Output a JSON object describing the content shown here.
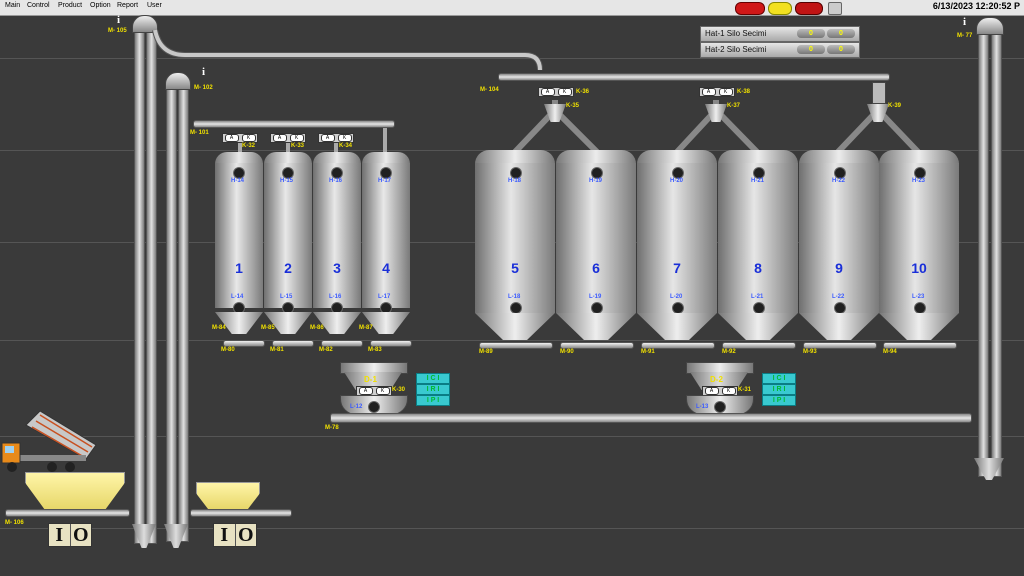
{
  "menu": [
    "Main",
    "Control",
    "Product",
    "Option",
    "Report",
    "User"
  ],
  "datetime": "6/13/2023 12:20:52 P",
  "line_panel": {
    "rows": [
      {
        "label": "Hat-1 Silo Secimi",
        "v1": "0",
        "v2": "0"
      },
      {
        "label": "Hat-2 Silo Secimi",
        "v1": "0",
        "v2": "0"
      }
    ]
  },
  "elevators": {
    "m105": "M- 105",
    "m102": "M- 102",
    "m101": "M- 101",
    "m104": "M- 104",
    "m77": "M- 77",
    "m106": "M- 106",
    "m78": "M-78"
  },
  "valves_small": [
    "K-32",
    "K-33",
    "K-34"
  ],
  "valves_large": [
    {
      "k_top": "K-36",
      "k_split": "K-35"
    },
    {
      "k_top": "K-38",
      "k_split": "K-37"
    },
    {
      "k_top": "",
      "k_split": "K-39"
    }
  ],
  "silos_small": [
    {
      "num": "1",
      "h": "H-14",
      "l": "L-14",
      "m_top": "M-84",
      "m_bot": "M-80"
    },
    {
      "num": "2",
      "h": "H-15",
      "l": "L-15",
      "m_top": "M-85",
      "m_bot": "M-81"
    },
    {
      "num": "3",
      "h": "H-16",
      "l": "L-16",
      "m_top": "M-86",
      "m_bot": "M-82"
    },
    {
      "num": "4",
      "h": "H-17",
      "l": "L-17",
      "m_top": "M-87",
      "m_bot": "M-83"
    }
  ],
  "silos_large": [
    {
      "num": "5",
      "h": "H-18",
      "l": "L-18",
      "m": "M-89"
    },
    {
      "num": "6",
      "h": "H-19",
      "l": "L-19",
      "m": "M-90"
    },
    {
      "num": "7",
      "h": "H-20",
      "l": "L-20",
      "m": "M-91"
    },
    {
      "num": "8",
      "h": "H-21",
      "l": "L-21",
      "m": "M-92"
    },
    {
      "num": "9",
      "h": "H-22",
      "l": "L-22",
      "m": "M-93"
    },
    {
      "num": "10",
      "h": "H-23",
      "l": "L-23",
      "m": "M-94"
    }
  ],
  "dosers": [
    {
      "name": "D-1",
      "k": "K-30",
      "l": "L-12",
      "buttons": [
        "I C I",
        "I R I",
        "I P I"
      ]
    },
    {
      "name": "D-2",
      "k": "K-31",
      "l": "L-13",
      "buttons": [
        "I C I",
        "I R I",
        "I P I"
      ]
    }
  ],
  "io_boxes": [
    [
      "I",
      "O"
    ],
    [
      "I",
      "O"
    ]
  ],
  "info_icon": "i",
  "colors": {
    "background": "#3a3a3a",
    "label": "#f0e000",
    "silo_number": "#1a2fd8",
    "control_button": "#39c9d0"
  }
}
